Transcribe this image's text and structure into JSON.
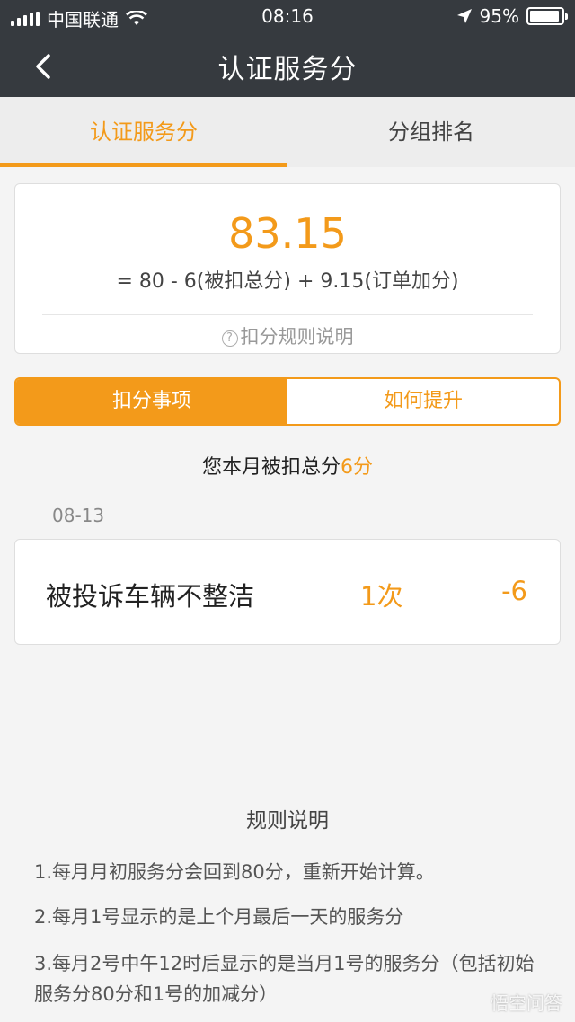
{
  "status_bar": {
    "carrier": "中国联通",
    "time": "08:16",
    "battery": "95%",
    "battery_level": 0.95
  },
  "header": {
    "title": "认证服务分"
  },
  "tabs": [
    {
      "label": "认证服务分",
      "active": true
    },
    {
      "label": "分组排名",
      "active": false
    }
  ],
  "score_card": {
    "score": "83.15",
    "formula": "= 80 - 6(被扣总分) + 9.15(订单加分)",
    "rule_link": "扣分规则说明"
  },
  "segment": {
    "active_label": "扣分事项",
    "inactive_label": "如何提升"
  },
  "deduction_summary": {
    "prefix": "您本月被扣总分",
    "value": "6分"
  },
  "records": [
    {
      "date": "08-13",
      "reason": "被投诉车辆不整洁",
      "count": "1次",
      "points": "-6"
    }
  ],
  "rules": {
    "title": "规则说明",
    "items": [
      "1.每月月初服务分会回到80分，重新开始计算。",
      "2.每月1号显示的是上个月最后一天的服务分",
      "3.每月2号中午12时后显示的是当月1号的服务分（包括初始服务分80分和1号的加减分）"
    ]
  },
  "watermark": "悟空问答",
  "colors": {
    "accent": "#f39a1a",
    "header_bg": "#363a3f",
    "page_bg": "#f4f4f4"
  }
}
